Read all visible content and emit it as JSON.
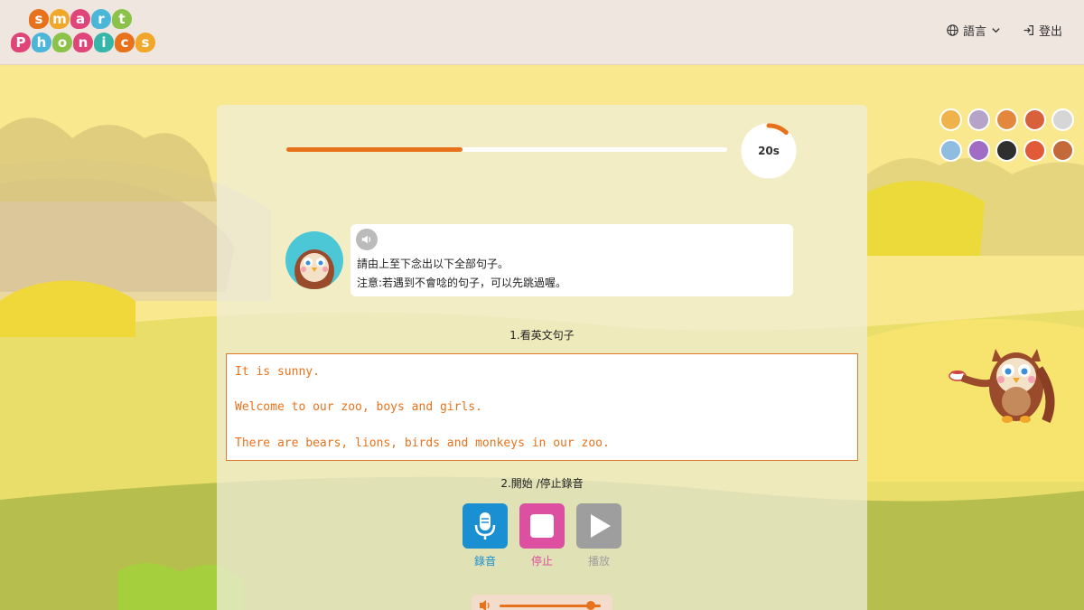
{
  "app": {
    "logo_row1": [
      "s",
      "m",
      "a",
      "r",
      "t"
    ],
    "logo_row2": [
      "P",
      "h",
      "o",
      "n",
      "i",
      "c",
      "s"
    ],
    "logo_colors": [
      "#e8721c",
      "#f0a72a",
      "#e0457a",
      "#4bb6d8",
      "#8bc34a",
      "#e0457a",
      "#35b6a8"
    ]
  },
  "header": {
    "language_label": "語言",
    "logout_label": "登出"
  },
  "exercise": {
    "progress": 0.4,
    "timer_text": "20s",
    "timer_fraction": 0.12,
    "instruction_line1": "請由上至下念出以下全部句子。",
    "instruction_line2": "注意:若遇到不會唸的句子，可以先跳過喔。",
    "step1_title": "1.看英文句子",
    "sentences": [
      "It is sunny.",
      "Welcome to our zoo, boys and girls.",
      "There are bears, lions, birds and monkeys in our zoo."
    ],
    "step2_title": "2.開始 /停止錄音",
    "record_label": "錄音",
    "stop_label": "停止",
    "play_label": "播放",
    "volume": 0.9
  },
  "colors": {
    "accent": "#e8721c",
    "record": "#1a8fd1",
    "stop": "#dd4fa0",
    "play_disabled": "#9e9e9e"
  },
  "characters": [
    "lion-icon",
    "hippo-icon",
    "squirrel-icon",
    "fox-icon",
    "penguin-icon",
    "elephant-icon",
    "octopus-icon",
    "toucan-icon",
    "parrot-icon",
    "owl-icon"
  ]
}
